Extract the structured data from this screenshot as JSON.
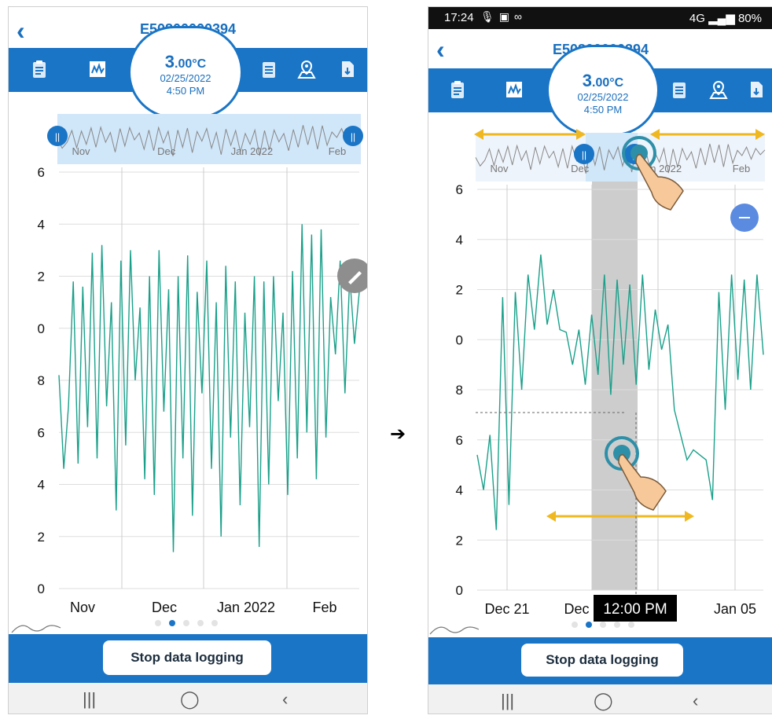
{
  "device_id": "E50800000394",
  "temperature": {
    "value": "3",
    "decimals": ".00",
    "unit": "°C"
  },
  "reading_date": "02/25/2022",
  "reading_time": "4:50 PM",
  "status_bar": {
    "time": "17:24",
    "signal": "4G",
    "battery": "80%"
  },
  "stop_button_label": "Stop data logging",
  "transition_arrow": "➔",
  "colors": {
    "accent": "#1a75c6",
    "series": "#1aa08a",
    "arrow": "#f0b820",
    "selection": "#d0e6f9"
  },
  "icons": [
    "back-icon",
    "clipboard-icon",
    "chart-icon",
    "notes-icon",
    "map-pin-icon",
    "export-icon",
    "handle-icon",
    "edit-icon",
    "minus-icon",
    "wave-icon",
    "touch-hand-icon"
  ],
  "overview": {
    "labels": [
      "Nov",
      "Dec",
      "Jan 2022",
      "Feb"
    ]
  },
  "chart_data": [
    {
      "type": "line",
      "title": "",
      "x": [
        "Nov",
        "Dec",
        "Jan 2022",
        "Feb"
      ],
      "y_tick_labels": [
        "0",
        "2",
        "4",
        "6",
        "8",
        "0",
        "2",
        "4",
        "6"
      ],
      "ylim": [
        0,
        16
      ],
      "series": [
        {
          "values": [
            8.2,
            4.6,
            7.0,
            11.8,
            4.8,
            11.6,
            6.2,
            12.9,
            5.0,
            13.2,
            7.0,
            11.0,
            3.0,
            12.6,
            5.5,
            13.0,
            8.0,
            10.8,
            4.2,
            12.0,
            3.6,
            13.0,
            6.8,
            11.5,
            1.4,
            12.0,
            5.0,
            12.8,
            2.8,
            11.4,
            7.5,
            12.6,
            4.6,
            11.0,
            2.0,
            12.4,
            5.8,
            11.8,
            3.2,
            10.6,
            6.2,
            12.0,
            1.6,
            11.8,
            4.0,
            12.0,
            7.2,
            10.6,
            3.6,
            12.2,
            5.0,
            14.0,
            6.0,
            13.6,
            4.2,
            13.8,
            5.8,
            11.2,
            9.0,
            12.6,
            7.5,
            12.0,
            9.4,
            11.4
          ]
        }
      ],
      "grid": true
    },
    {
      "type": "line",
      "title": "",
      "x": [
        "Dec 21",
        "Dec 2",
        "Jan 05"
      ],
      "y_tick_labels": [
        "0",
        "2",
        "4",
        "6",
        "8",
        "0",
        "2",
        "4",
        "6"
      ],
      "ylim": [
        0,
        16
      ],
      "series": [
        {
          "values": [
            5.4,
            4.0,
            6.2,
            2.4,
            11.7,
            3.4,
            11.9,
            8.0,
            12.6,
            10.4,
            13.4,
            10.6,
            12.0,
            10.4,
            10.3,
            9.0,
            10.4,
            8.2,
            11.0,
            8.6,
            12.6,
            7.8,
            12.4,
            9.0,
            12.2,
            8.2,
            12.6,
            8.8,
            11.2,
            9.6,
            10.6,
            7.2,
            6.2,
            5.2,
            5.6,
            5.4,
            5.2,
            3.6,
            11.9,
            7.2,
            12.6,
            8.4,
            12.4,
            8.0,
            12.6,
            9.4
          ]
        }
      ],
      "grid": true,
      "cursor_label": "12:00 PM"
    }
  ]
}
